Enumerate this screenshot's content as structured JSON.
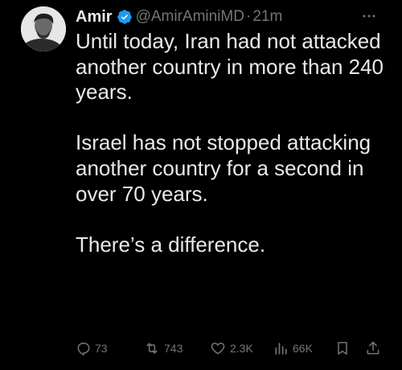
{
  "author": {
    "name": "Amir",
    "handle": "@AmirAminiMD",
    "separator": "·",
    "time": "21m",
    "verified_icon": "verified-badge-icon",
    "verified_color": "#1d9bf0"
  },
  "tweet": {
    "paragraphs": [
      "Until today, Iran had not attacked another country in more than 240 years.",
      "Israel has not stopped attacking  another country for a second in over 70 years.",
      "There’s a difference."
    ]
  },
  "actions": {
    "replies": "73",
    "retweets": "743",
    "likes": "2.3K",
    "views": "66K"
  },
  "colors": {
    "background": "#000000",
    "text": "#e7e9ea",
    "secondary": "#71767b"
  }
}
